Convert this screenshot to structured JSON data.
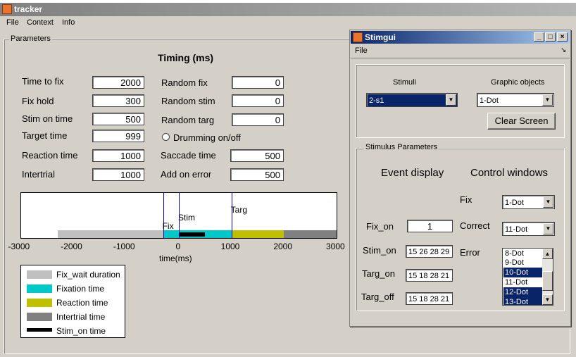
{
  "tracker": {
    "title": "tracker",
    "menu": [
      "File",
      "Context",
      "Info"
    ],
    "parameters_group_label": "Parameters",
    "timing_heading": "Timing (ms)",
    "fields_left": [
      {
        "label": "Time to fix",
        "value": "2000"
      },
      {
        "label": "Fix hold",
        "value": "300"
      },
      {
        "label": "Stim on time",
        "value": "500"
      },
      {
        "label": "Target time",
        "value": "999"
      },
      {
        "label": "Reaction time",
        "value": "1000"
      },
      {
        "label": "Intertrial",
        "value": "1000"
      }
    ],
    "fields_right": [
      {
        "label": "Random fix",
        "value": "0"
      },
      {
        "label": "Random stim",
        "value": "0"
      },
      {
        "label": "Random targ",
        "value": "0"
      },
      {
        "label": "Saccade time",
        "value": "500"
      },
      {
        "label": "Add on error",
        "value": "500"
      }
    ],
    "drumming_label": "Drumming on/off",
    "drumming_checked": false
  },
  "chart_data": {
    "type": "timeline",
    "xlabel": "time(ms)",
    "xlim": [
      -3000,
      3000
    ],
    "xticks": [
      "-3000",
      "-2000",
      "-1000",
      "0",
      "1000",
      "2000",
      "3000"
    ],
    "markers": [
      {
        "label": "Fix",
        "x": -300
      },
      {
        "label": "Stim",
        "x": 0
      },
      {
        "label": "Targ",
        "x": 1000
      }
    ],
    "bars": [
      {
        "name": "Fix_wait duration",
        "start": -2300,
        "end": -300,
        "color": "#c0c0c0"
      },
      {
        "name": "Fixation time",
        "start": -300,
        "end": 1000,
        "color": "#00c8c8"
      },
      {
        "name": "Reaction time",
        "start": 1000,
        "end": 2000,
        "color": "#c0c000"
      },
      {
        "name": "Intertrial time",
        "start": 2000,
        "end": 3000,
        "color": "#808080"
      }
    ],
    "stim_on": {
      "name": "Stim_on time",
      "start": 0,
      "end": 500,
      "color": "#000000"
    },
    "legend": [
      {
        "name": "Fix_wait duration",
        "color": "#c0c0c0"
      },
      {
        "name": "Fixation time",
        "color": "#00c8c8"
      },
      {
        "name": "Reaction time",
        "color": "#c0c000"
      },
      {
        "name": "Intertrial time",
        "color": "#808080"
      },
      {
        "name": "Stim_on time",
        "color": "#000000"
      }
    ]
  },
  "stimgui": {
    "title": "Stimgui",
    "menu_file": "File",
    "stimuli_label": "Stimuli",
    "stimuli_value": "2-s1",
    "graphic_objects_label": "Graphic objects",
    "graphic_objects_value": "1-Dot",
    "clear_screen": "Clear Screen",
    "stim_params_label": "Stimulus Parameters",
    "event_display": "Event display",
    "control_windows": "Control windows",
    "rows": [
      {
        "label": "Fix_on",
        "value": "1"
      },
      {
        "label": "Stim_on",
        "value": "15 26 28 29"
      },
      {
        "label": "Targ_on",
        "value": "15 18 28 21"
      },
      {
        "label": "Targ_off",
        "value": "15 18 28 21"
      }
    ],
    "fix_label": "Fix",
    "fix_value": "1-Dot",
    "correct_label": "Correct",
    "correct_value": "11-Dot",
    "error_label": "Error",
    "error_options": [
      "8-Dot",
      "9-Dot",
      "10-Dot",
      "11-Dot",
      "12-Dot",
      "13-Dot"
    ],
    "error_selected": [
      "10-Dot",
      "12-Dot",
      "13-Dot"
    ]
  },
  "colors": {
    "stimgui_title": "#0a246a",
    "selection": "#0a246a"
  }
}
